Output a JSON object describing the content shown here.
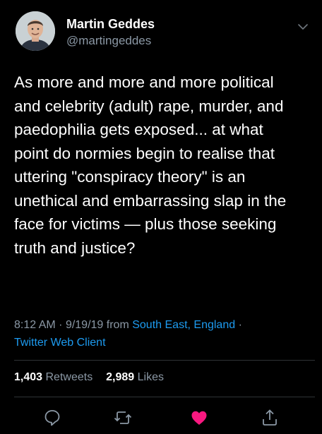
{
  "user": {
    "display_name": "Martin Geddes",
    "handle": "@martingeddes",
    "avatar_icon": "avatar-photo"
  },
  "tweet": {
    "text": "As more and more and more political\nand celebrity (adult) rape, murder, and\npaedophilia gets exposed... at what\npoint do normies begin to realise that\nuttering \"conspiracy theory\" is an\nunethical and embarrassing slap in the\nface for victims — plus those seeking\ntruth and justice?"
  },
  "meta": {
    "time": "8:12 AM",
    "date": "9/19/19",
    "from_label": "from",
    "location": "South East, England",
    "separator": "·",
    "client": "Twitter Web Client"
  },
  "stats": {
    "retweets_count": "1,403",
    "retweets_label": "Retweets",
    "likes_count": "2,989",
    "likes_label": "Likes"
  },
  "actions": [
    {
      "icon": "reply-icon"
    },
    {
      "icon": "retweet-icon"
    },
    {
      "icon": "heart-icon",
      "liked": true
    },
    {
      "icon": "share-icon"
    }
  ],
  "colors": {
    "background": "#000000",
    "text": "#ffffff",
    "secondary": "#8b98a5",
    "link": "#1d9bf0",
    "like": "#f91880"
  }
}
